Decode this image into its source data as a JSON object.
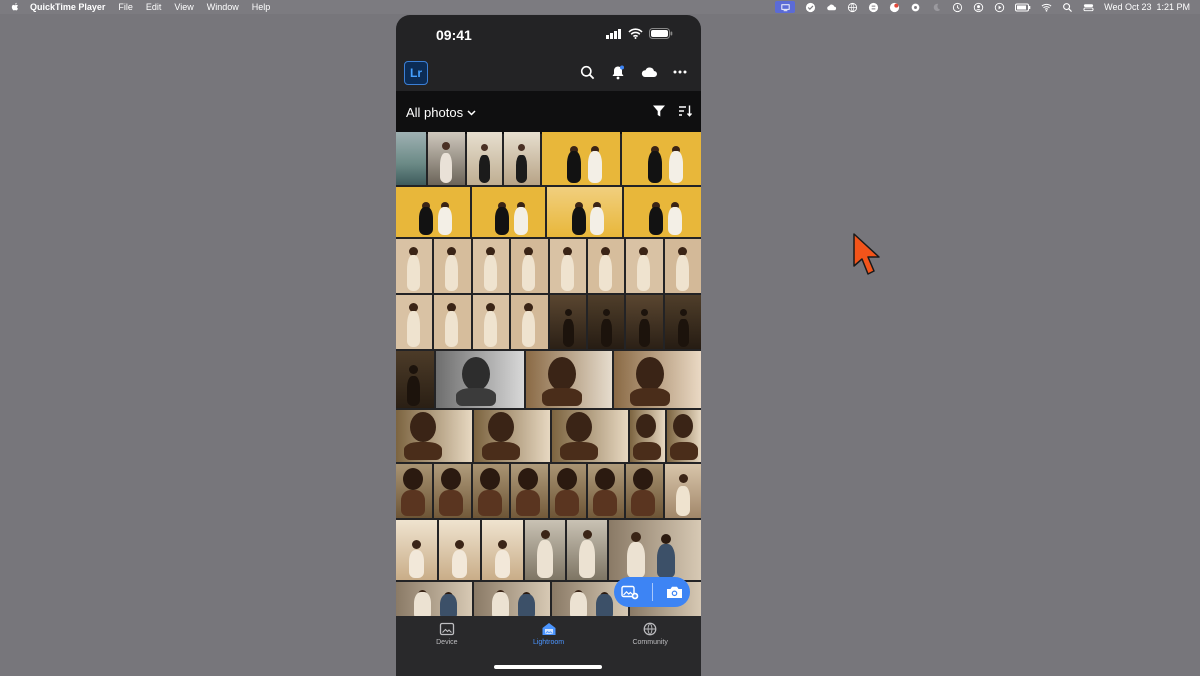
{
  "menubar": {
    "app_name": "QuickTime Player",
    "menus": [
      "File",
      "Edit",
      "View",
      "Window",
      "Help"
    ],
    "date_time": "Wed Oct 23  1:21 PM",
    "status_icons": [
      "screen-share-icon",
      "checkmark-icon",
      "cloud-icon",
      "globe-icon",
      "sync-icon",
      "record-icon",
      "gear-icon",
      "moon-icon",
      "clock-icon",
      "user-icon",
      "play-icon",
      "battery-icon",
      "wifi-icon",
      "search-icon",
      "control-center-icon"
    ]
  },
  "phone": {
    "time": "09:41",
    "app_badge": "Lr",
    "album_label": "All photos",
    "nav": [
      {
        "label": "Device",
        "icon": "device-folder-icon",
        "active": false
      },
      {
        "label": "Lightroom",
        "icon": "lightroom-home-icon",
        "active": true
      },
      {
        "label": "Community",
        "icon": "globe-icon",
        "active": false
      }
    ]
  },
  "colors": {
    "accent": "#3d84f4",
    "yellow_backdrop": "#e8b73a",
    "sepia_light": "#d9c2a4",
    "dark_scene": "#3a2c1e"
  }
}
